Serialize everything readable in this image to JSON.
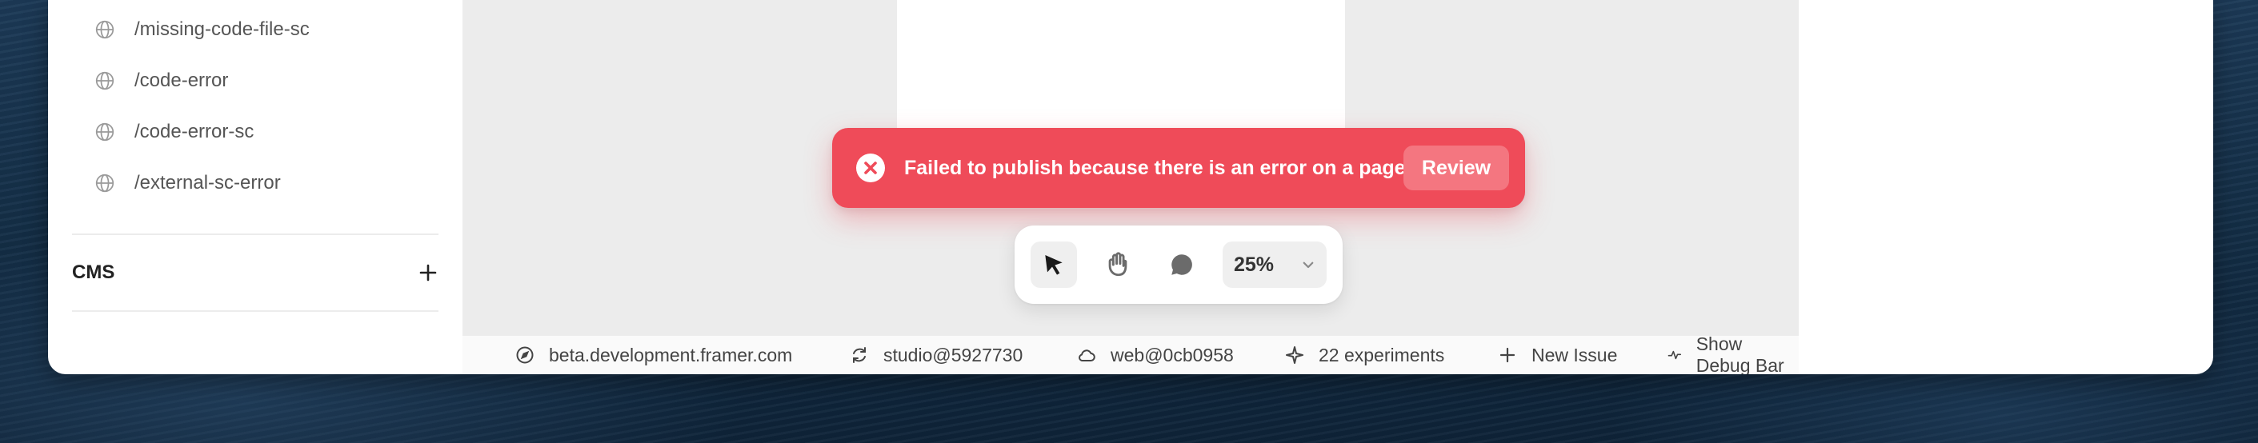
{
  "sidebar": {
    "pages": [
      {
        "label": "/missing-code-file-sc",
        "icon": "globe-icon"
      },
      {
        "label": "/code-error",
        "icon": "globe-icon"
      },
      {
        "label": "/code-error-sc",
        "icon": "globe-icon"
      },
      {
        "label": "/external-sc-error",
        "icon": "globe-icon"
      }
    ],
    "cms": {
      "title": "CMS",
      "add_icon": "plus-icon"
    }
  },
  "toast": {
    "message": "Failed to publish because there is an error on a page",
    "action_label": "Review",
    "icon": "error-icon",
    "color": "#ef4b59"
  },
  "toolbar": {
    "tools": [
      {
        "name": "select-tool",
        "icon": "cursor-icon",
        "active": true
      },
      {
        "name": "hand-tool",
        "icon": "hand-icon",
        "active": false
      },
      {
        "name": "comment-tool",
        "icon": "comment-icon",
        "active": false
      }
    ],
    "zoom": "25%"
  },
  "statusbar": {
    "domain": "beta.development.framer.com",
    "studio": "studio@5927730",
    "web": "web@0cb0958",
    "experiments": "22 experiments",
    "new_issue": "New Issue",
    "debug": "Show Debug Bar"
  }
}
